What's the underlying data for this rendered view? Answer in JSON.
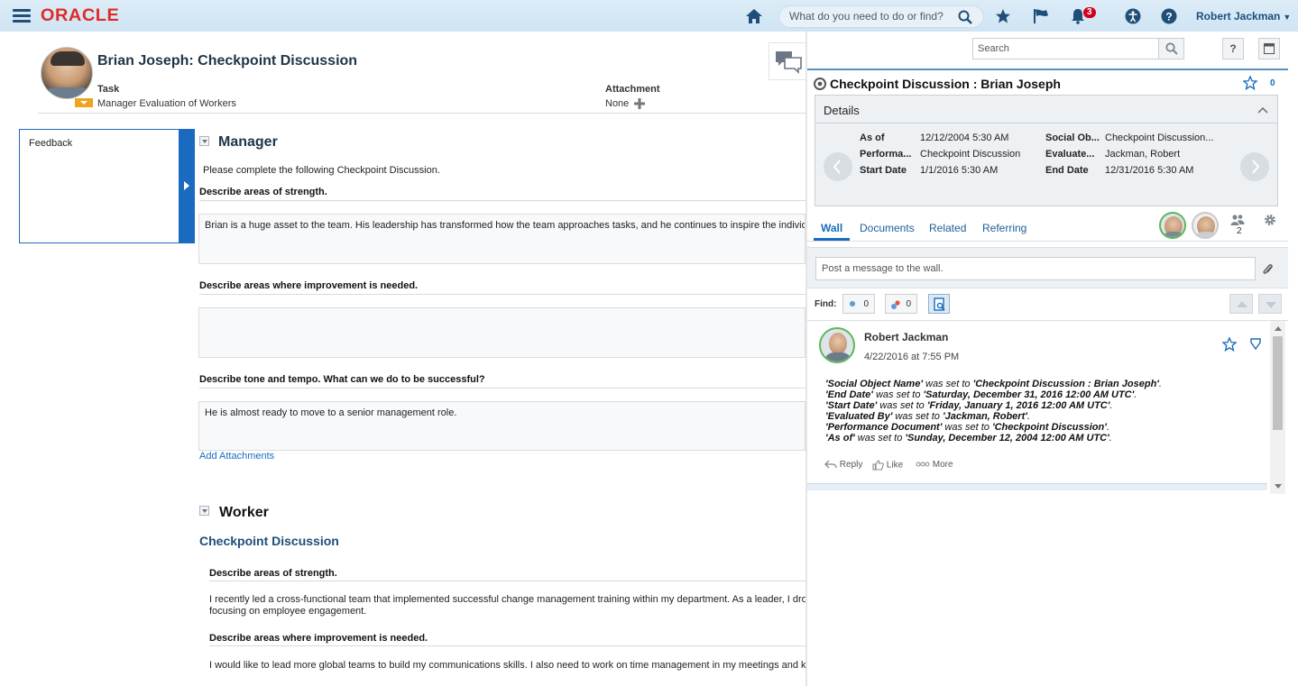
{
  "header": {
    "logo": "ORACLE",
    "search_placeholder": "What do you need to do or find?",
    "notification_count": "3",
    "user_name": "Robert Jackman"
  },
  "page": {
    "title": "Brian Joseph: Checkpoint Discussion",
    "task_label": "Task",
    "task_value": "Manager Evaluation of Workers",
    "attachment_label": "Attachment",
    "attachment_value": "None"
  },
  "feedback": {
    "label": "Feedback"
  },
  "manager": {
    "heading": "Manager",
    "intro": "Please complete the following Checkpoint Discussion.",
    "questions": [
      {
        "label": "Describe areas of strength.",
        "answer": "Brian is a huge asset to the team. His leadership has transformed how the team approaches tasks, and he continues to inspire the individua"
      },
      {
        "label": "Describe areas where improvement is needed.",
        "answer": ""
      },
      {
        "label": "Describe tone and tempo. What can we do to be successful?",
        "answer": "He is almost ready to move to a senior management role."
      }
    ],
    "add_attachments": "Add Attachments"
  },
  "worker": {
    "heading": "Worker",
    "subheading": "Checkpoint Discussion",
    "questions": [
      {
        "label": "Describe areas of strength.",
        "answer_line1": "I recently led a cross-functional team that implemented successful change management training within my department. As a leader, I drove",
        "answer_line2": "focusing on employee engagement."
      },
      {
        "label": "Describe areas where improvement is needed.",
        "answer_line1": "I would like to lead more global teams to build my communications skills. I also need to work on time management in my meetings and kee"
      }
    ]
  },
  "social": {
    "search_placeholder": "Search",
    "help_label": "?",
    "title": "Checkpoint Discussion : Brian Joseph",
    "star_count": "0",
    "details": {
      "heading": "Details",
      "fields": [
        {
          "key": "As of",
          "value": "12/12/2004 5:30 AM"
        },
        {
          "key": "Performa...",
          "value": "Checkpoint Discussion"
        },
        {
          "key": "Start Date",
          "value": "1/1/2016 5:30 AM"
        },
        {
          "key": "Social Ob...",
          "value": "Checkpoint Discussion..."
        },
        {
          "key": "Evaluate...",
          "value": "Jackman, Robert"
        },
        {
          "key": "End Date",
          "value": "12/31/2016 5:30 AM"
        }
      ]
    },
    "tabs": [
      "Wall",
      "Documents",
      "Related",
      "Referring"
    ],
    "members_count": "2",
    "post_placeholder": "Post a message to the wall.",
    "find_label": "Find:",
    "find_count_1": "0",
    "find_count_2": "0",
    "post": {
      "author": "Robert Jackman",
      "time": "4/22/2016 at 7:55 PM",
      "lines": [
        {
          "field": "'Social Object Name'",
          "mid": " was set to ",
          "value": "'Checkpoint Discussion : Brian Joseph'",
          "end": "."
        },
        {
          "field": "'End Date'",
          "mid": " was set to ",
          "value": "'Saturday, December 31, 2016 12:00 AM UTC'",
          "end": "."
        },
        {
          "field": "'Start Date'",
          "mid": " was set to ",
          "value": "'Friday, January 1, 2016 12:00 AM UTC'",
          "end": "."
        },
        {
          "field": "'Evaluated By'",
          "mid": " was set to ",
          "value": "'Jackman, Robert'",
          "end": "."
        },
        {
          "field": "'Performance Document'",
          "mid": " was set to ",
          "value": "'Checkpoint Discussion'",
          "end": "."
        },
        {
          "field": "'As of'",
          "mid": " was set to ",
          "value": "'Sunday, December 12, 2004 12:00 AM UTC'",
          "end": "."
        }
      ],
      "reply": "Reply",
      "like": "Like",
      "more": "More"
    }
  }
}
